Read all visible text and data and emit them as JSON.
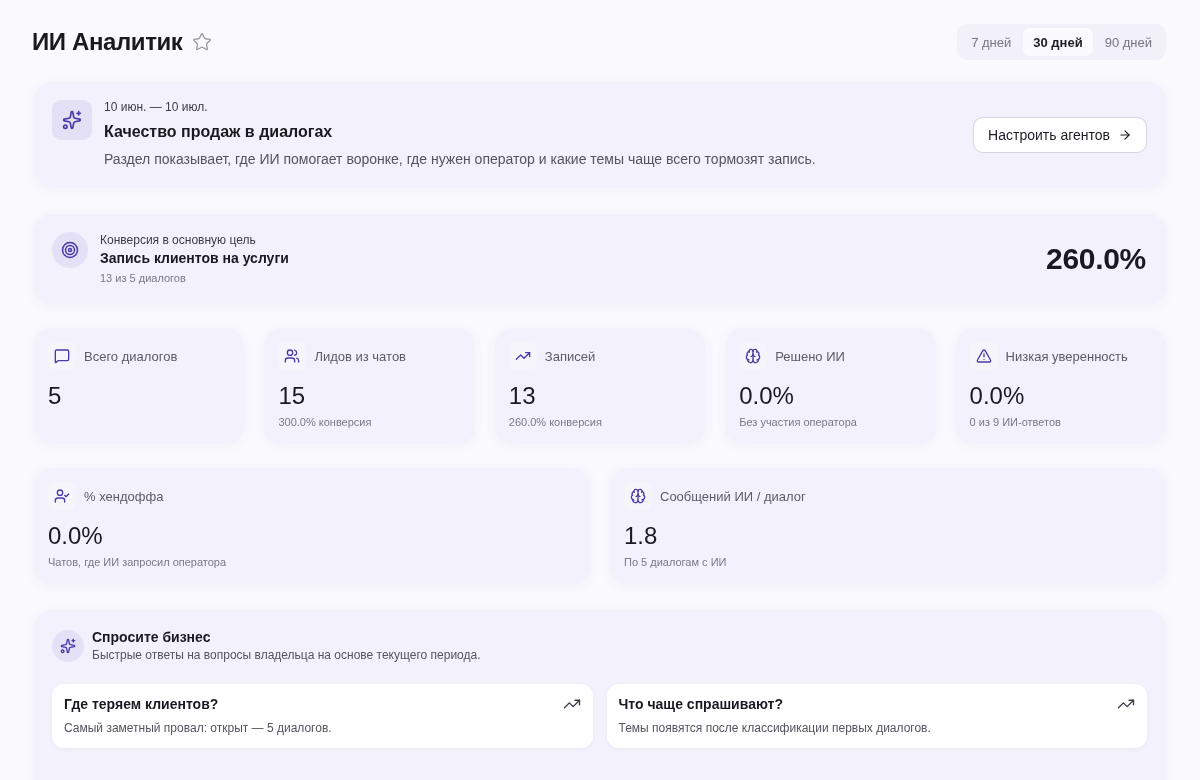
{
  "header": {
    "title": "ИИ Аналитик",
    "favorite": false,
    "periods": [
      {
        "label": "7 дней",
        "selected": false
      },
      {
        "label": "30 дней",
        "selected": true
      },
      {
        "label": "90 дней",
        "selected": false
      }
    ]
  },
  "summary": {
    "date_range": "10 июн. — 10 июл.",
    "title": "Качество продаж в диалогах",
    "description": "Раздел показывает, где ИИ помогает воронке, где нужен оператор и какие темы чаще всего тормозят запись.",
    "button": "Настроить агентов"
  },
  "goal": {
    "label": "Конверсия в основную цель",
    "title": "Запись клиентов на услуги",
    "note": "13 из 5 диалогов",
    "value": "260.0%"
  },
  "metrics": [
    {
      "label": "Всего диалогов",
      "value": "5"
    },
    {
      "label": "Лидов из чатов",
      "value": "15",
      "note": "300.0% конверсия"
    },
    {
      "label": "Записей",
      "value": "13",
      "note": "260.0% конверсия"
    },
    {
      "label": "Решено ИИ",
      "value": "0.0%",
      "note": "Без участия оператора"
    },
    {
      "label": "Низкая уверенность",
      "value": "0.0%",
      "note": "0 из 9 ИИ-ответов"
    }
  ],
  "secondary_metrics": [
    {
      "label": "% хендоффа",
      "value": "0.0%",
      "note": "Чатов, где ИИ запросил оператора"
    },
    {
      "label": "Сообщений ИИ / диалог",
      "value": "1.8",
      "note": "По 5 диалогам с ИИ"
    }
  ],
  "ask": {
    "title": "Спросите бизнес",
    "subtitle": "Быстрые ответы на вопросы владельца на основе текущего периода.",
    "questions": [
      {
        "title": "Где теряем клиентов?",
        "answer": "Самый заметный провал: открыт — 5 диалогов."
      },
      {
        "title": "Что чаще спрашивают?",
        "answer": "Темы появятся после классификации первых диалогов."
      }
    ]
  }
}
